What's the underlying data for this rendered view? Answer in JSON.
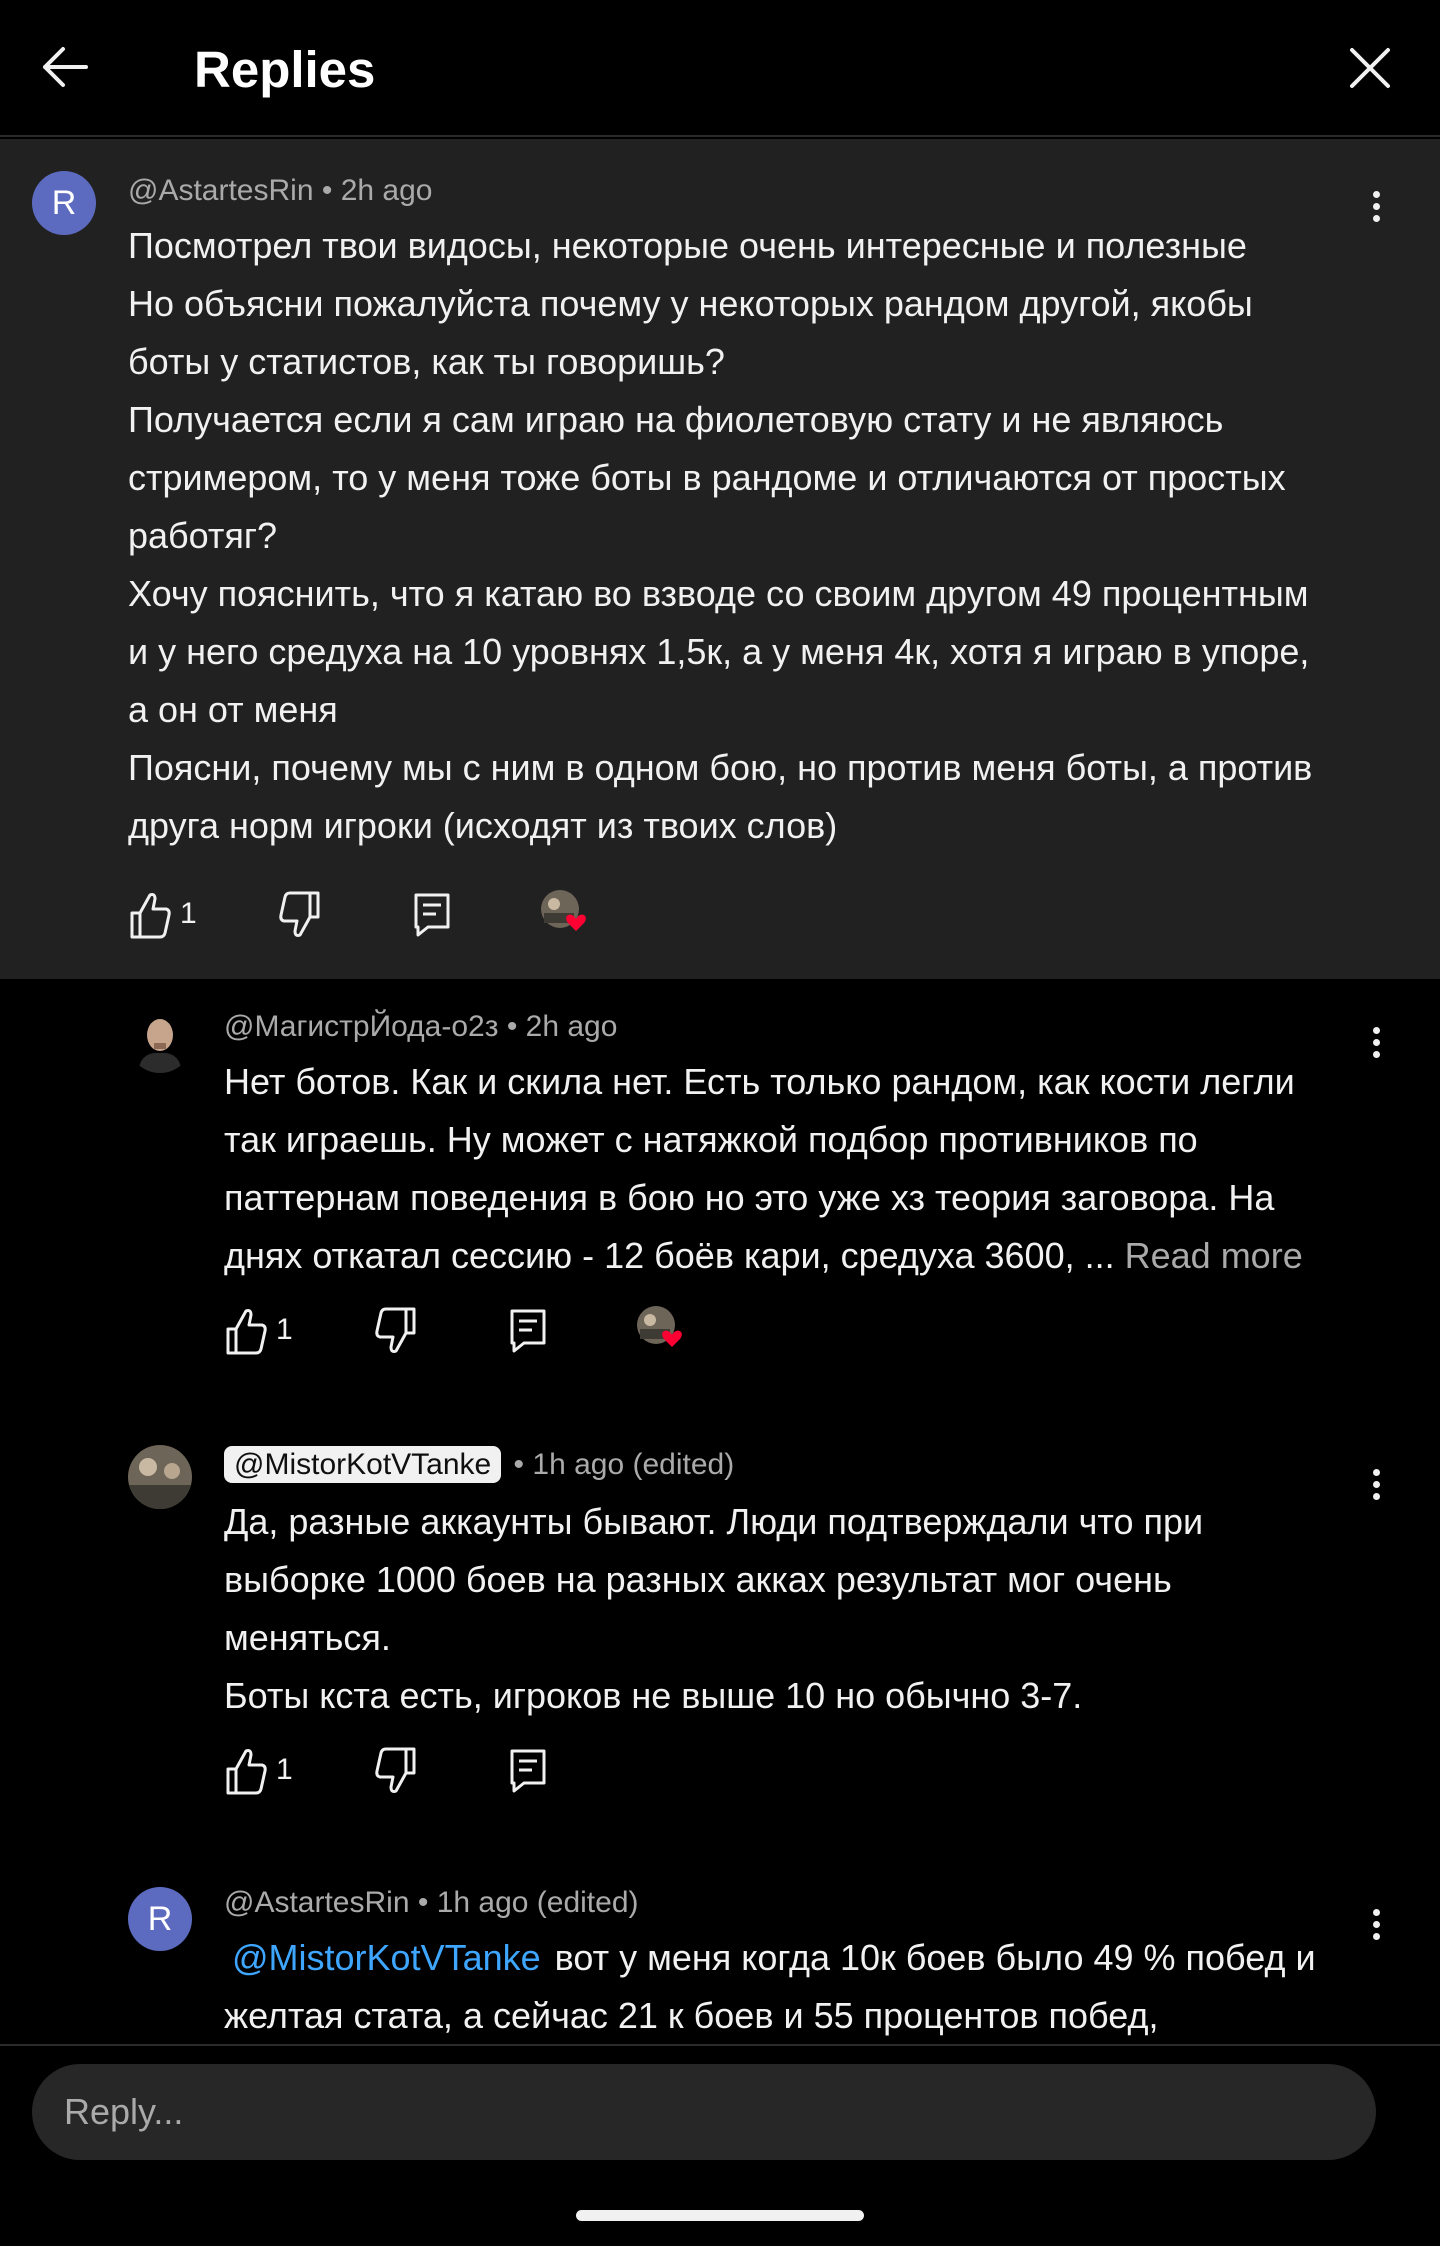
{
  "header": {
    "title": "Replies"
  },
  "parent": {
    "avatar_letter": "R",
    "author": "@AstartesRin",
    "time": " • 2h ago",
    "lines": [
      "Посмотрел твои видосы, некоторые очень интересные и полезные",
      "Но объясни пожалуйста почему у некоторых рандом другой, якобы",
      "боты у статистов, как ты говоришь?",
      "Получается если я сам играю на фиолетовую стату и не являюсь",
      "стримером, то у меня тоже боты в рандоме и отличаются от простых",
      "работяг?",
      "Хочу пояснить, что я катаю во взводе со своим другом 49 процентным",
      "и у него средуха на 10 уровнях 1,5к, а у меня 4к, хотя я играю в упоре,",
      "а он от меня",
      "Поясни, почему мы с ним в одном бою, но против меня боты, а против",
      "друга норм игроки (исходят из твоих слов)"
    ],
    "likes": "1"
  },
  "replies": [
    {
      "author": "@МагистрЙода-о2з",
      "time": " • 2h ago",
      "lines": [
        "Нет ботов. Как и скила нет. Есть только рандом, как кости легли",
        "так играешь. Ну может с натяжкой подбор противников по",
        "паттернам поведения в бою но это уже хз теория заговора. На",
        "днях откатал сессию - 12 боёв кари, средуха 3600, ... "
      ],
      "read_more": "Read more",
      "likes": "1"
    },
    {
      "author": "@MistorKotVTanke",
      "time": " • 1h ago (edited)",
      "lines": [
        "Да, разные аккаунты бывают. Люди подтверждали что при",
        "выборке 1000 боев на разных акках результат мог очень",
        "меняться.",
        "Боты кста есть, игроков не выше 10 но обычно 3-7."
      ],
      "likes": "1"
    },
    {
      "avatar_letter": "R",
      "author": "@AstartesRin",
      "time": " • 1h ago (edited)",
      "mention": "@MistorKotVTanke",
      "line1_rest": "вот у меня когда 10к боев было 49 % побед и",
      "line2": "желтая стата, а сейчас 21 к боев и 55 процентов побед,"
    }
  ],
  "reply_box": {
    "placeholder": "Reply..."
  },
  "colors": {
    "accent_link": "#3ea6ff",
    "heart": "#ff0033",
    "letter_avatar": "#5c6bc0"
  },
  "icons": [
    "back-arrow-icon",
    "close-icon",
    "thumbs-up-icon",
    "thumbs-down-icon",
    "reply-icon",
    "more-vert-icon",
    "creator-heart-icon"
  ]
}
